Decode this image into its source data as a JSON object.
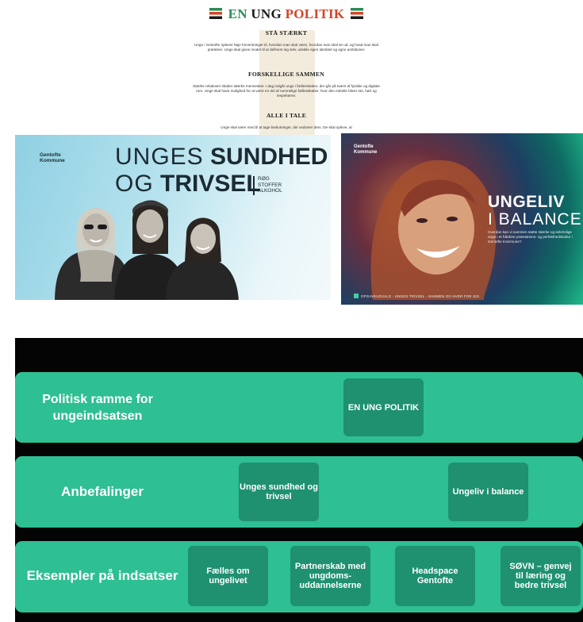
{
  "document": {
    "title_parts": [
      "EN",
      "UNG",
      "POLITIK"
    ],
    "sections": [
      {
        "heading": "STÅ STÆRKT",
        "text": "Unge i Gentofte oplever høje forventninger til, hvordan man skal være, hvordan man skal se ud, og hvad man skal præstere. Unge skal gives modet til at definere sig selv, udvikle egen identitet og egne ambitioner."
      },
      {
        "heading": "FORSKELLIGE SAMMEN",
        "text": "Stærke relationer skaber stærke mennesker. I dag indgår unge i fællesskaber, der går på tværs af fysiske og digitale rum. Unge skal have mulighed for at være en del af rummelige fællesskaber, hvor den enkelte bliver set, hørt og respekteret."
      },
      {
        "heading": "ALLE I TALE",
        "text": "Unge skal være med til at tage beslutninger, der vedrører dem. De skal opleve, at"
      }
    ]
  },
  "brochure_health": {
    "logo_line1": "Gentofte",
    "logo_line2": "Kommune",
    "title_a": "UNGES",
    "title_b": "SUNDHED",
    "title_c": "OG",
    "title_d": "TRIVSEL",
    "subtitle_1": "RØG",
    "subtitle_2": "STOFFER",
    "subtitle_3": "ALKOHOL"
  },
  "brochure_balance": {
    "logo_line1": "Gentofte",
    "logo_line2": "Kommune",
    "title_1": "UNGELIV",
    "title_2": "I BALANCE",
    "subtitle": "Hvordan kan vi sammen støtte stærke og selvtrolige unge i et hårdere præstations- og perfekthedskultur i Gentofte Kommune?",
    "footer": "OPGAVEUDVALG - UNGES TRIVSEL - SAMMEN OG HVER FOR SIG"
  },
  "diagram": {
    "rows": [
      {
        "label": "Politisk ramme for ungeindsatsen",
        "items": [
          "EN UNG POLITIK"
        ]
      },
      {
        "label": "Anbefalinger",
        "items": [
          "Unges sundhed og trivsel",
          "Ungeliv i balance"
        ]
      },
      {
        "label": "Eksempler på indsatser",
        "items": [
          "Fælles om ungelivet",
          "Partnerskab med ungdoms-uddannelserne",
          "Headspace Gentofte",
          "SØVN – genvej til læring og bedre trivsel"
        ]
      }
    ]
  },
  "colors": {
    "band": "#2ebf93",
    "box": "#1f9170",
    "background": "#040404",
    "doc_green": "#2e8b57",
    "doc_red": "#d0462a"
  }
}
